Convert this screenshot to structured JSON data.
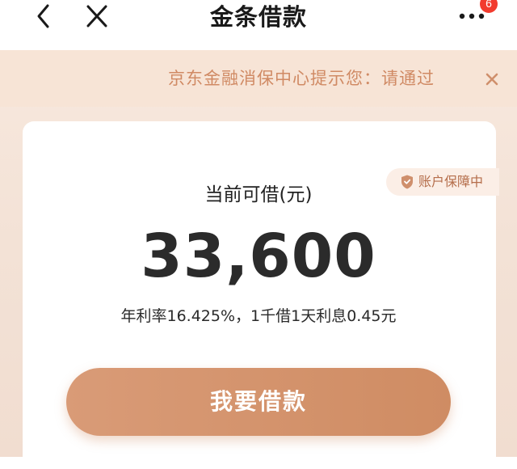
{
  "navbar": {
    "title": "金条借款",
    "back_icon": "chevron-left-icon",
    "close_icon": "close-icon",
    "more_icon": "more-dots-icon",
    "badge_count": "6"
  },
  "notice": {
    "text": "京东金融消保中心提示您：请通过",
    "color": "#d08a64"
  },
  "card": {
    "secure_badge": "账户保障中",
    "available_label": "当前可借(元)",
    "amount": "33,600",
    "rate_text": "年利率16.425%，1千借1天利息0.45元",
    "borrow_button": "我要借款"
  },
  "colors": {
    "accent": "#d39470",
    "badge_red": "#f23b2e"
  }
}
